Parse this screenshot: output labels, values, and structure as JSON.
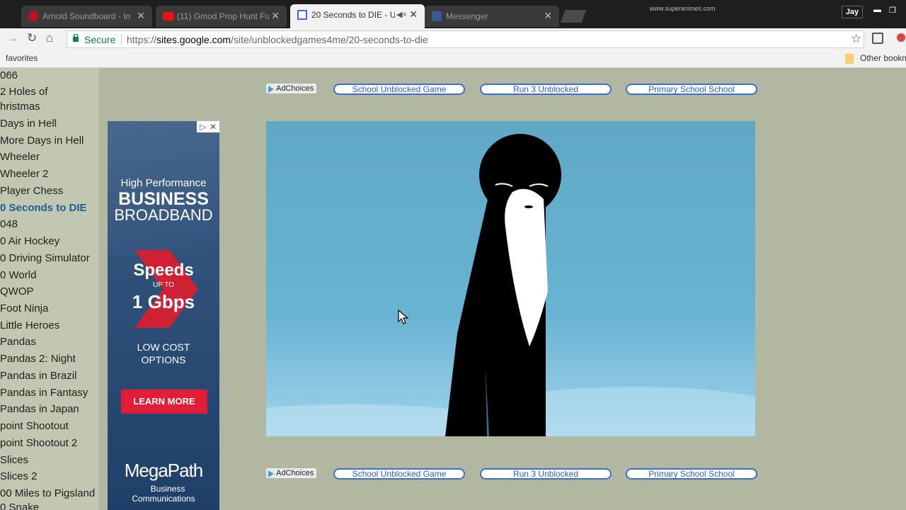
{
  "tabs": [
    {
      "title": "Arnold Soundboard - In",
      "favicon": "red-circle",
      "active": false
    },
    {
      "title": "(11) Gmod Prop Hunt Fu",
      "favicon": "youtube",
      "active": false
    },
    {
      "title": "20 Seconds to DIE - U",
      "favicon": "sites-page",
      "active": true
    },
    {
      "title": "Messenger",
      "favicon": "facebook",
      "active": false
    }
  ],
  "watermark": "www.superanimes.com",
  "user_name": "Jay",
  "security_label": "Secure",
  "url_prefix": "https://",
  "url_host": "sites.google.com",
  "url_path": "/site/unblockedgames4me/20-seconds-to-die",
  "bookmarks": {
    "left": "favorites",
    "right": "Other bookm"
  },
  "sidebar_items": [
    "066",
    "2 Holes of",
    "hristmas",
    "Days in Hell",
    "More Days in Hell",
    "Wheeler",
    "Wheeler 2",
    "Player Chess",
    "0 Seconds to DIE",
    "048",
    "0 Air Hockey",
    "0 Driving Simulator",
    "0 World",
    "QWOP",
    "Foot Ninja",
    "Little Heroes",
    "Pandas",
    "Pandas 2: Night",
    "Pandas in Brazil",
    "Pandas in Fantasy",
    "Pandas in Japan",
    "point Shootout",
    "point Shootout 2",
    "Slices",
    "Slices 2",
    "00 Miles to Pigsland",
    "0 Snake"
  ],
  "sidebar_current": "0 Seconds to DIE",
  "ad": {
    "line1": "High Performance",
    "line2": "BUSINESS",
    "line3": "BROADBAND",
    "speeds": "Speeds",
    "up_to": "UP TO",
    "gbps": "1 Gbps",
    "low_cost": "LOW COST",
    "options": "OPTIONS",
    "cta": "LEARN MORE",
    "brand": "MegaPath",
    "brand_sub1": "Business",
    "brand_sub2": "Communications"
  },
  "ad_choices_label": "AdChoices",
  "ad_links": [
    "School Unblocked Game",
    "Run 3 Unblocked",
    "Primary School School"
  ],
  "colors": {
    "page_bg": "#b2b7a2",
    "sidebar_bg": "#c1c7b0",
    "secure_green": "#0b8043",
    "ad_red": "#e31d37",
    "sky": "#68b2d2"
  }
}
